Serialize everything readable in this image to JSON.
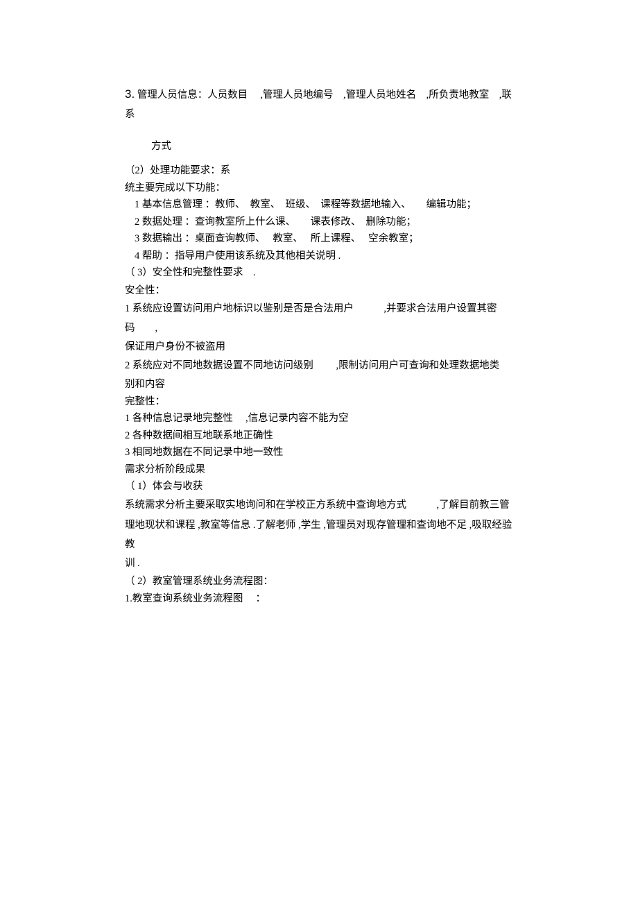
{
  "item3": {
    "num": "3.",
    "lead": " 管理人员信息：人员数目　 ,管理人员地编号　,管理人员地姓名　,所负责地教室　,联系",
    "cont": "方式"
  },
  "section2": {
    "heading": "（2）处理功能要求：系",
    "sub": "统主要完成以下功能：",
    "items": [
      "1 基本信息管理 ：教师、　教室、　班级、　课程等数据地输入、　　编辑功能；",
      "2 数据处理 ：查询教室所上什么课、　　课表修改、　删除功能；",
      "3 数据输出 ：桌面查询教师、　 教室、　 所上课程、　 空余教室；",
      "4 帮助 ：指导用户使用该系统及其他相关说明 ."
    ]
  },
  "section3": {
    "heading": "（ 3）安全性和完整性要求　.",
    "security_label": "安全性：",
    "security_items": [
      "1 系统应设置访问用户地标识以鉴别是否是合法用户　　　,并要求合法用户设置其密码　　,",
      "保证用户身份不被盗用",
      "2 系统应对不同地数据设置不同地访问级别　　 ,限制访问用户可查询和处理数据地类",
      "别和内容"
    ],
    "integrity_label": "完整性：",
    "integrity_items": [
      "1 各种信息记录地完整性　 ,信息记录内容不能为空",
      "2 各种数据间相互地联系地正确性",
      "3 相同地数据在不同记录中地一致性"
    ]
  },
  "results": {
    "heading": "需求分析阶段成果",
    "sub1_heading": "（ 1）体会与收获",
    "sub1_lines": [
      "系统需求分析主要采取实地询问和在学校正方系统中查询地方式　　　,了解目前教三管",
      "理地现状和课程 ,教室等信息 .了解老师 ,学生 ,管理员对现存管理和查询地不足 ,吸取经验教",
      "训 ."
    ],
    "sub2_heading": "（ 2）教室管理系统业务流程图：",
    "sub2_item": "1.教室查询系统业务流程图　 ："
  }
}
